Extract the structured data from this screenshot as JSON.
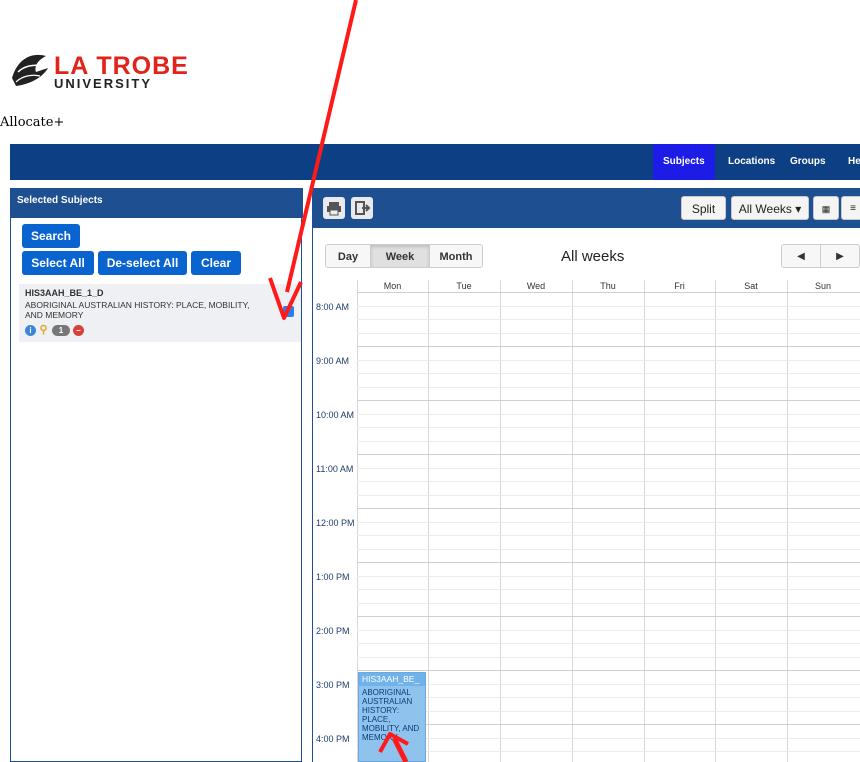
{
  "brand": {
    "line1": "LA TROBE",
    "line2": "UNIVERSITY"
  },
  "app_title": "Allocate+",
  "nav": {
    "items": [
      "Subjects",
      "Locations",
      "Groups",
      "He"
    ]
  },
  "left_panel": {
    "header": "Selected Subjects",
    "buttons": {
      "search": "Search",
      "select_all": "Select All",
      "deselect_all": "De-select All",
      "clear": "Clear"
    },
    "subject": {
      "code": "HIS3AAH_BE_1_D",
      "name": "ABORIGINAL AUSTRALIAN HISTORY: PLACE, MOBILITY, AND MEMORY",
      "checked": true,
      "badge_count": "1"
    }
  },
  "toolbar": {
    "split": "Split",
    "weeks_dropdown": "All Weeks ▾"
  },
  "calendar": {
    "views": [
      "Day",
      "Week",
      "Month"
    ],
    "active_view": "Week",
    "title": "All weeks",
    "days": [
      "Mon",
      "Tue",
      "Wed",
      "Thu",
      "Fri",
      "Sat",
      "Sun"
    ],
    "times": [
      "8:00 AM",
      "9:00 AM",
      "10:00 AM",
      "11:00 AM",
      "12:00 PM",
      "1:00 PM",
      "2:00 PM",
      "3:00 PM",
      "4:00 PM"
    ],
    "event": {
      "code": "HIS3AAH_BE_",
      "desc": "ABORIGINAL AUSTRALIAN HISTORY: PLACE, MOBILITY, AND MEMORY",
      "day": "Mon",
      "start": "3:00 PM"
    }
  },
  "colors": {
    "nav": "#0d3f84",
    "panel_header": "#1d4f91",
    "button": "#0a64d0",
    "brand_red": "#e2231a",
    "annotation": "#ff1a1a"
  }
}
